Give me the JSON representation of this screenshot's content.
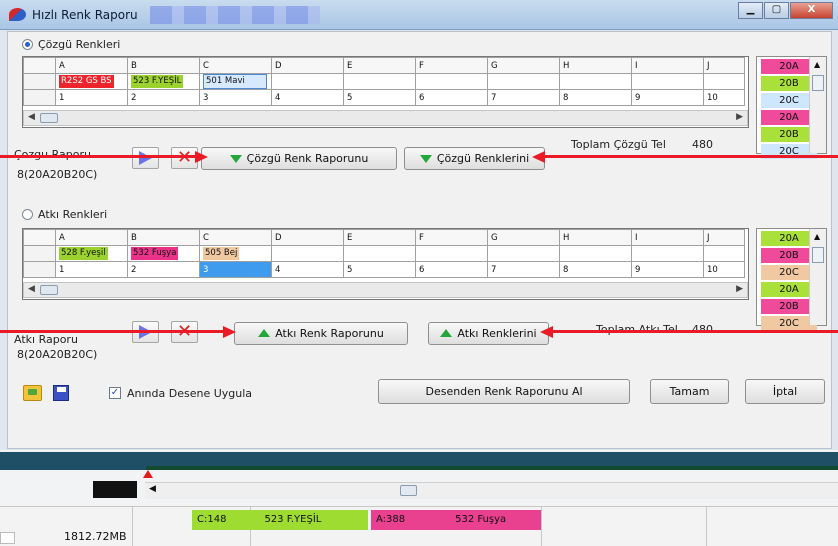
{
  "window": {
    "title": "Hızlı Renk Raporu",
    "controls": [
      "▁",
      "▢",
      "X"
    ]
  },
  "warp": {
    "section_label": "Çözgü Renkleri",
    "columns": [
      "A",
      "B",
      "C",
      "D",
      "E",
      "F",
      "G",
      "H",
      "I",
      "J"
    ],
    "colors_row": [
      "R2S2 GS BS",
      "523 F.YEŞİL",
      "501 Mavi"
    ],
    "numbers_row": [
      "1",
      "2",
      "3",
      "4",
      "5",
      "6",
      "7",
      "8",
      "9",
      "10"
    ],
    "codes": [
      "20A",
      "20B",
      "20C",
      "20A",
      "20B",
      "20C"
    ],
    "report_label": "Çozgu Raporu",
    "report_button": "Çözgü Renk Raporunu",
    "colors_button": "Çözgü Renklerini",
    "total_label": "Toplam Çözgü Tel",
    "total_value": "480",
    "report_value": "8(20A20B20C)"
  },
  "weft": {
    "section_label": "Atkı Renkleri",
    "columns": [
      "A",
      "B",
      "C",
      "D",
      "E",
      "F",
      "G",
      "H",
      "I",
      "J"
    ],
    "colors_row": [
      "528 F.yeşil",
      "532 Fuşya",
      "505 Bej"
    ],
    "numbers_row": [
      "1",
      "2",
      "3",
      "4",
      "5",
      "6",
      "7",
      "8",
      "9",
      "10"
    ],
    "codes": [
      "20A",
      "20B",
      "20C",
      "20A",
      "20B",
      "20C"
    ],
    "report_label": "Atkı Raporu",
    "report_button": "Atkı Renk Raporunu",
    "colors_button": "Atkı Renklerini",
    "total_label": "Toplam Atkı Tel",
    "total_value": "480",
    "report_value": "8(20A20B20C)"
  },
  "footer": {
    "apply_label": "Anında Desene Uygula",
    "apply_checked": true,
    "get_report_button": "Desenden Renk Raporunu Al",
    "ok_button": "Tamam",
    "cancel_button": "İptal"
  },
  "status": {
    "c_label": "C:148",
    "c_name": "523 F.YEŞİL",
    "a_label": "A:388",
    "a_name": "532 Fuşya",
    "memory": "1812.72MB"
  },
  "colors": {
    "red": "#ed242b",
    "green": "#9bd22e",
    "blue": "#d6e9ff",
    "pink": "#ea3289",
    "beige": "#f0c8a0",
    "arrow": "#ea1b26"
  }
}
